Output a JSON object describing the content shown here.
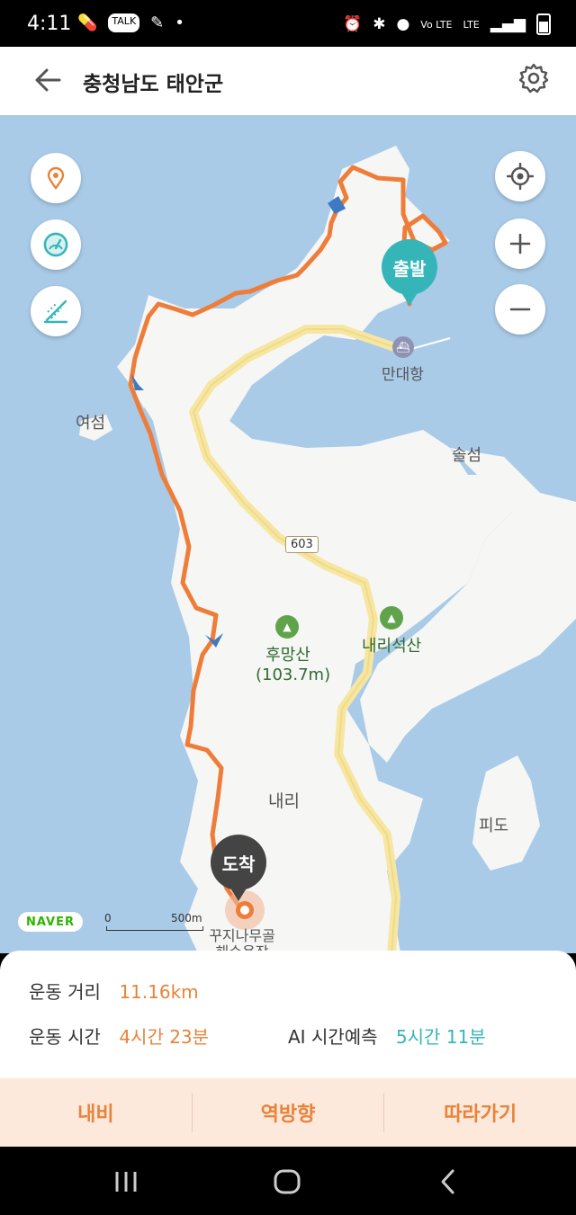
{
  "status_bar": {
    "time": "4:11",
    "left_icons": [
      "pill-icon",
      "kakaotalk-icon",
      "app-icon",
      "dot-icon"
    ],
    "right_icons": [
      "alarm-icon",
      "bluetooth-icon",
      "location-icon",
      "volte-icon",
      "lte-icon",
      "signal-icon",
      "battery-icon"
    ],
    "volte_text": "Vo LTE",
    "lte_text": "LTE"
  },
  "header": {
    "title": "충청남도 태안군"
  },
  "map": {
    "labels": {
      "yeoseom": "여섬",
      "solseom": "솔섬",
      "mandae_port": "만대항",
      "humangsan": "후망산",
      "humangsan_height": "(103.7m)",
      "naeriseoksan": "내리석산",
      "naeri": "내리",
      "pido": "피도",
      "campground": "꾸지나무골",
      "campground_line2": "해수욕장"
    },
    "road_number": "603",
    "start_pin": "출발",
    "end_pin": "도착",
    "naver": "NAVER",
    "scale_0": "0",
    "scale_1": "500m",
    "colors": {
      "route": "#ee7d3a",
      "water": "#a9cbe8",
      "land": "#f6f6f4",
      "road": "#f7e6a0"
    }
  },
  "stats": {
    "distance_label": "운동 거리",
    "distance_value": "11.16km",
    "time_label": "운동 시간",
    "time_value": "4시간 23분",
    "ai_label": "AI 시간예측",
    "ai_value": "5시간 11분"
  },
  "actions": {
    "nav": "내비",
    "reverse": "역방향",
    "follow": "따라가기"
  }
}
